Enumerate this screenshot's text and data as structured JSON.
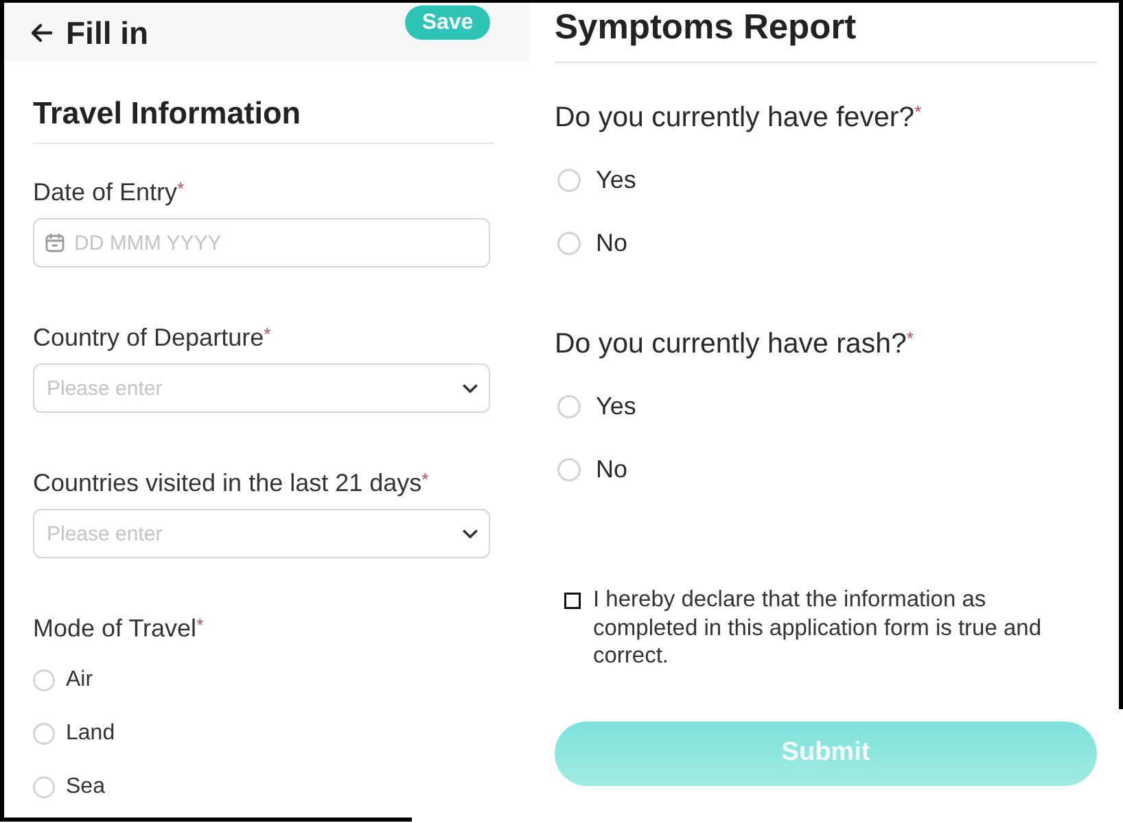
{
  "header": {
    "title": "Fill in",
    "save_button": "Save"
  },
  "travel_information": {
    "title": "Travel Information",
    "fields": [
      {
        "kind": "date",
        "label": "Date of Entry",
        "required_mark": "*",
        "placeholder": "DD MMM YYYY"
      },
      {
        "kind": "select",
        "label": "Country of Departure",
        "required_mark": "*",
        "placeholder": "Please enter"
      },
      {
        "kind": "select",
        "label": "Countries visited in the last 21 days",
        "required_mark": "*",
        "placeholder": "Please enter"
      },
      {
        "kind": "radio",
        "label": "Mode of Travel",
        "required_mark": "*",
        "options": [
          {
            "label": "Air",
            "selected": false
          },
          {
            "label": "Land",
            "selected": false
          },
          {
            "label": "Sea",
            "selected": false
          }
        ]
      }
    ]
  },
  "symptoms_report": {
    "title": "Symptoms Report",
    "questions": [
      {
        "label": "Do you currently have fever?",
        "required_mark": "*",
        "options": [
          {
            "label": "Yes",
            "selected": false
          },
          {
            "label": "No",
            "selected": false
          }
        ]
      },
      {
        "label": "Do you currently have rash?",
        "required_mark": "*",
        "options": [
          {
            "label": "Yes",
            "selected": false
          },
          {
            "label": "No",
            "selected": false
          }
        ]
      }
    ],
    "declaration": {
      "text": "I hereby declare that the information as completed in this application form is true and correct.",
      "checked": false
    },
    "submit_button": {
      "label": "Submit",
      "disabled": true
    }
  }
}
